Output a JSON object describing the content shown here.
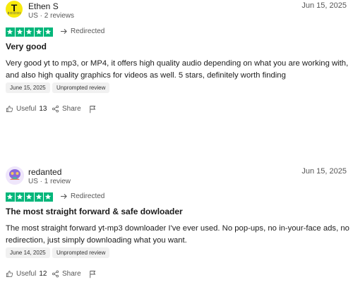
{
  "reviews": [
    {
      "avatar_initial": "T",
      "reviewer_name": "Ethen S",
      "reviewer_meta": "US · 2 reviews",
      "date": "Jun 15, 2025",
      "rating": 5,
      "redirected_label": "Redirected",
      "title": "Very good",
      "text": "Very good yt to mp3, or MP4, it offers high quality audio depending on what you are working with, and also high quality graphics for videos as well. 5 stars, definitely worth finding",
      "experience_date": "June 15, 2025",
      "review_type": "Unprompted review",
      "useful_label": "Useful",
      "useful_count": "13",
      "share_label": "Share"
    },
    {
      "avatar_initial": "",
      "reviewer_name": "redanted",
      "reviewer_meta": "US · 1 review",
      "date": "Jun 15, 2025",
      "rating": 5,
      "redirected_label": "Redirected",
      "title": "The most straight forward & safe dowloader",
      "text": "The most straight forward yt-mp3 downloader I've ever used. No pop-ups, no in-your-face ads, no redirection, just simply downloading what you want.",
      "experience_date": "June 14, 2025",
      "review_type": "Unprompted review",
      "useful_label": "Useful",
      "useful_count": "12",
      "share_label": "Share"
    }
  ],
  "colors": {
    "star_green": "#00b67a",
    "avatar_yellow": "#f7e90c",
    "text_dark": "#1c1c1c",
    "text_muted": "#575757",
    "chip_bg": "#f1f1f1"
  }
}
